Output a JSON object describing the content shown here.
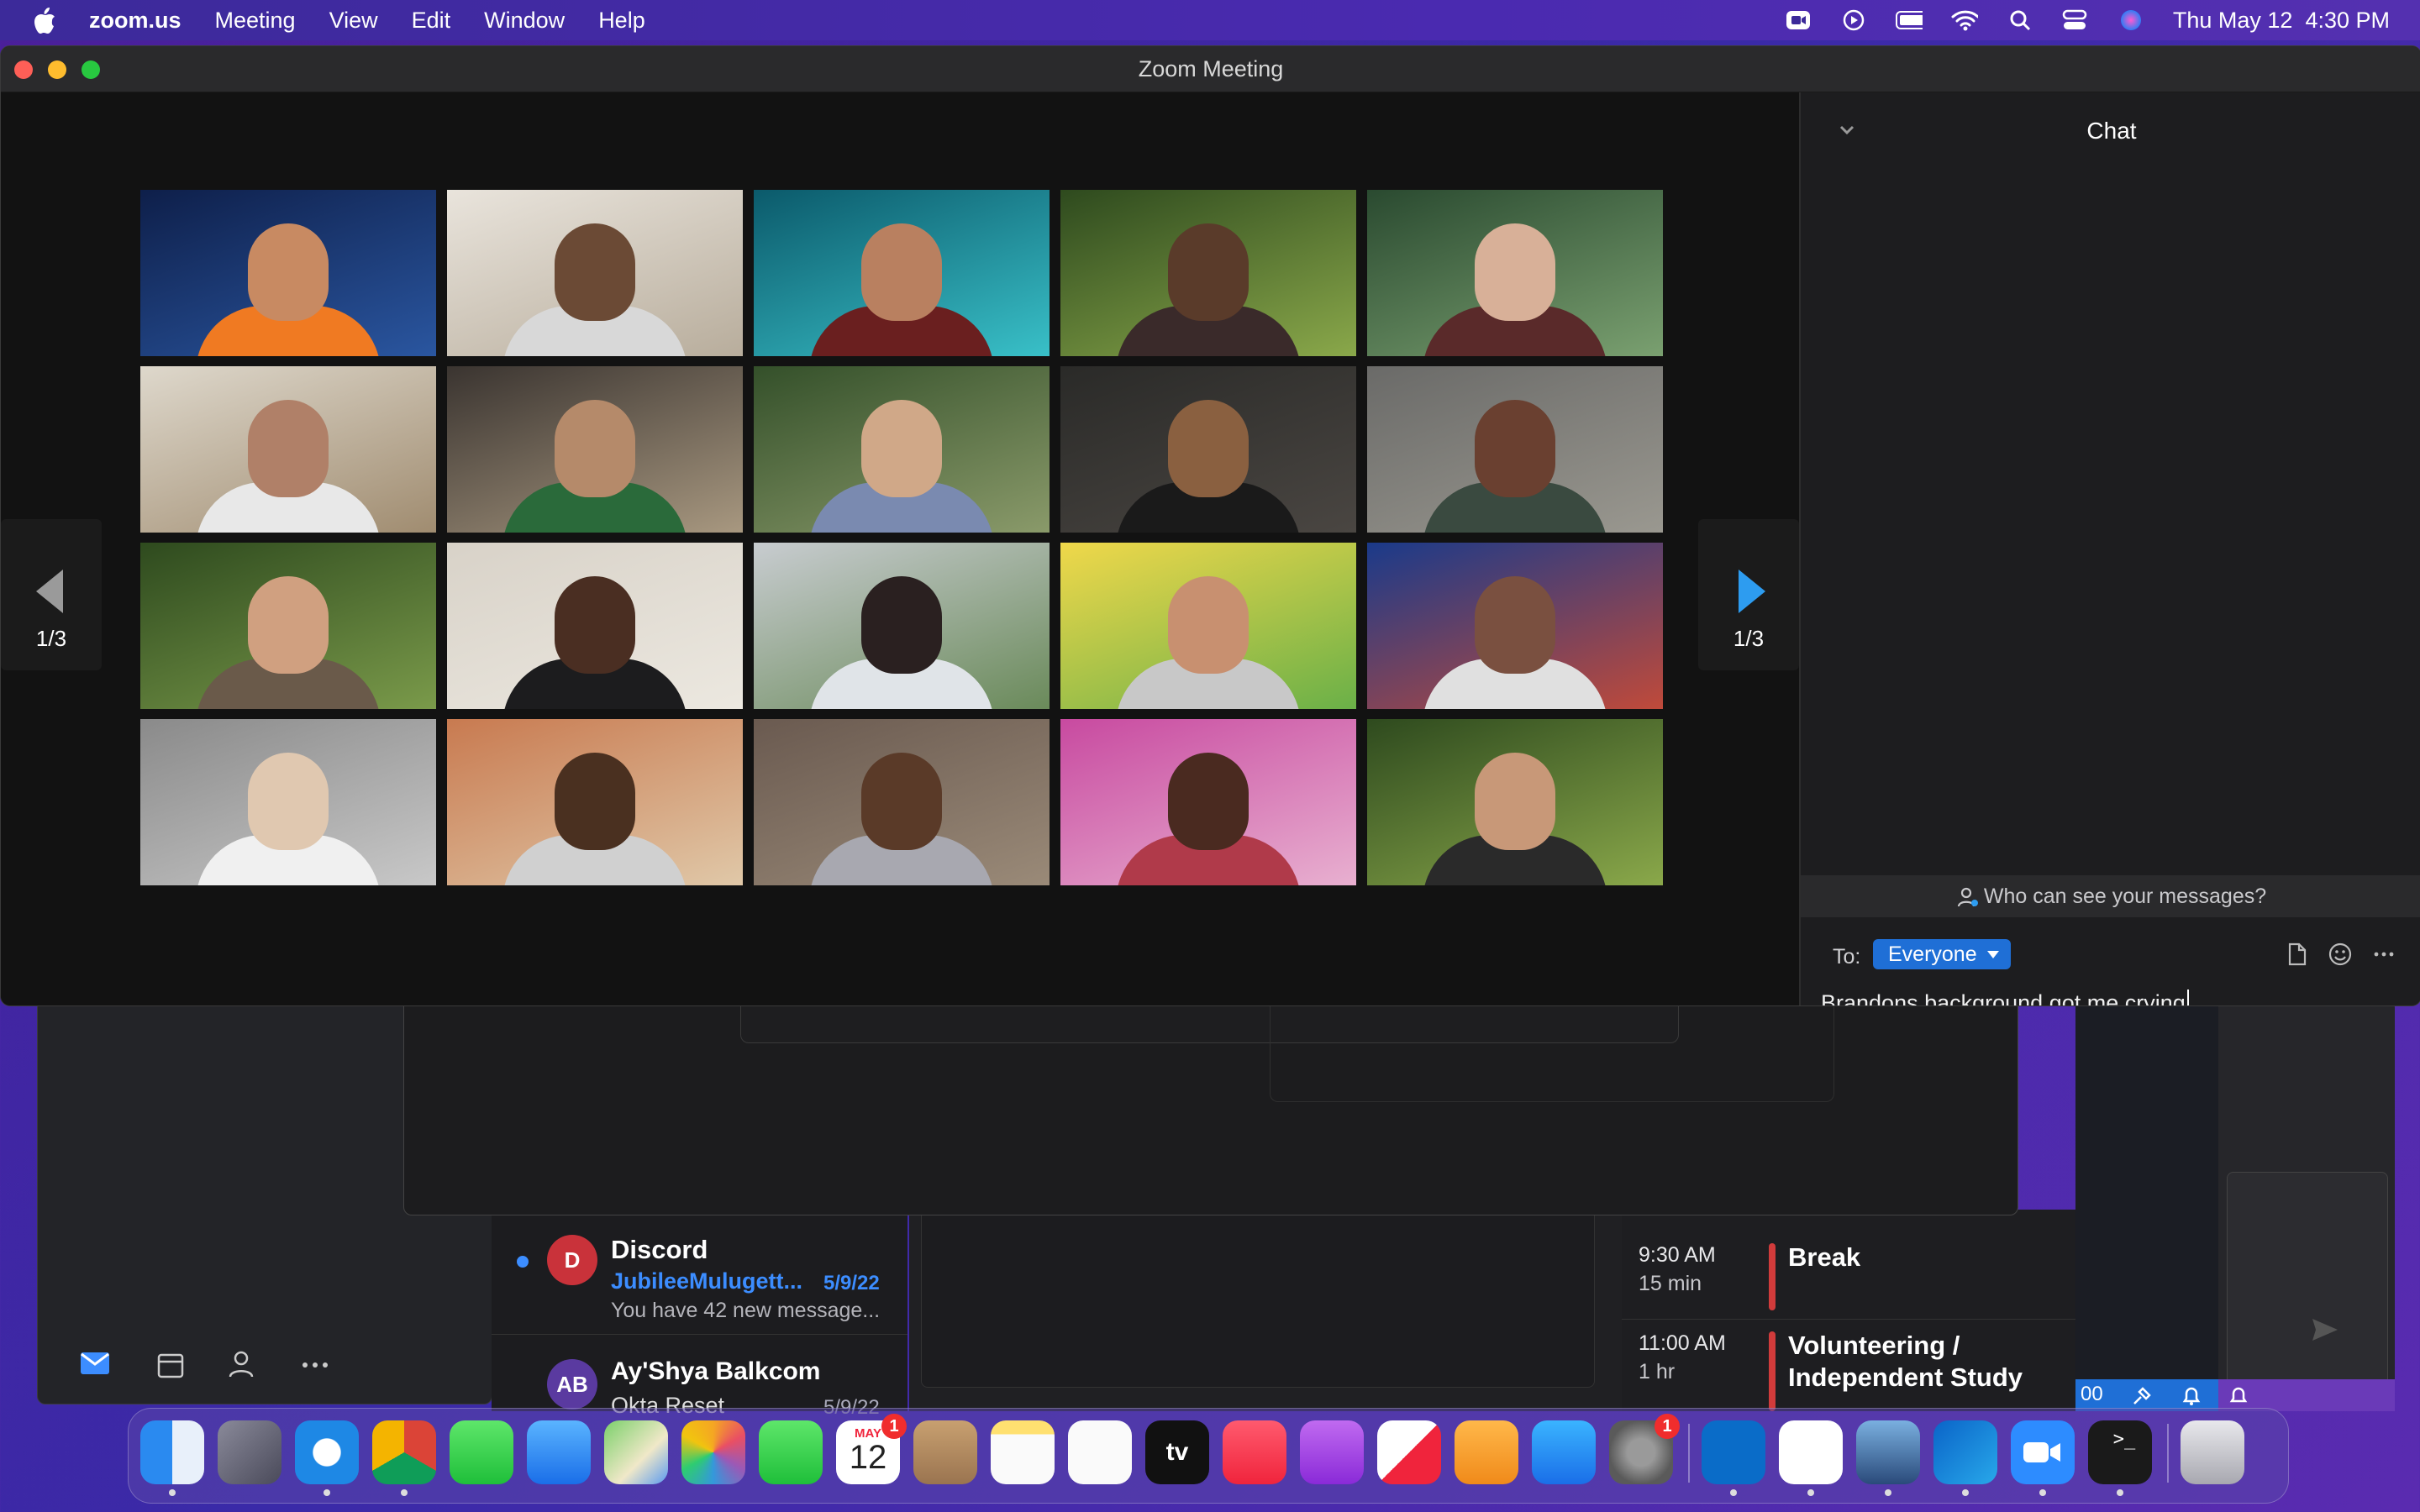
{
  "menubar": {
    "app_name": "zoom.us",
    "menus": [
      "Meeting",
      "View",
      "Edit",
      "Window",
      "Help"
    ],
    "clock": "Thu May 12  4:30 PM"
  },
  "zoom": {
    "window_title": "Zoom Meeting",
    "page_indicator_left": "1/3",
    "page_indicator_right": "1/3",
    "participants_shown": 20
  },
  "chat": {
    "title": "Chat",
    "who_can_see": "Who can see your messages?",
    "to_label": "To:",
    "recipient": "Everyone",
    "draft_message": "Brandons background got me crying"
  },
  "mail": {
    "items": [
      {
        "avatar": "D",
        "sender": "Discord",
        "subject": "JubileeMulugett...",
        "date": "5/9/22",
        "preview": "You have 42 new message...",
        "unread": true
      },
      {
        "avatar": "AB",
        "sender": "Ay'Shya Balkcom",
        "subject": "Okta Reset",
        "date": "5/9/22",
        "preview": "",
        "unread": false
      }
    ]
  },
  "calendar": {
    "events": [
      {
        "time": "9:30 AM",
        "duration": "15 min",
        "title_line1": "Break",
        "title_line2": ""
      },
      {
        "time": "11:00 AM",
        "duration": "1 hr",
        "title_line1": "Volunteering /",
        "title_line2": "Independent Study"
      }
    ]
  },
  "teams_strip": {
    "fragment": "00"
  },
  "dock": {
    "calendar_month": "MAY",
    "calendar_day": "12",
    "calendar_badge": "1",
    "settings_badge": "1",
    "tv_label": "tv"
  },
  "colors": {
    "accent_blue": "#1f6fd6",
    "zoom_bg": "#121212",
    "chat_bg": "#1d1d1f",
    "badge_red": "#f02d2d"
  }
}
